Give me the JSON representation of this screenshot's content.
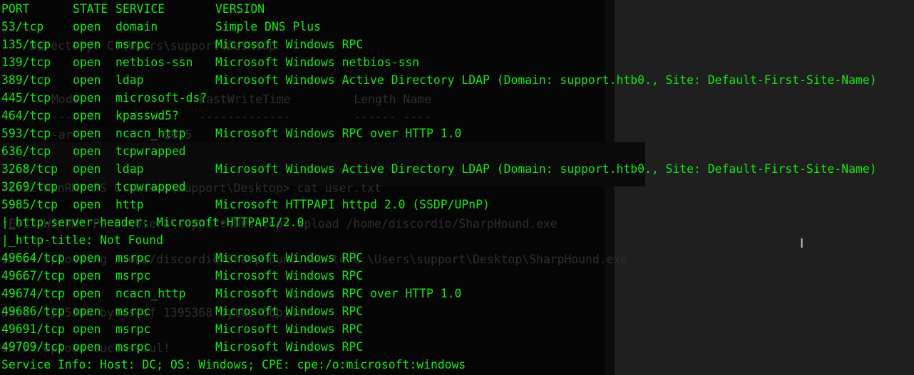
{
  "terminal": {
    "header": {
      "port": "PORT",
      "state": "STATE",
      "service": "SERVICE",
      "version": "VERSION"
    },
    "rows": [
      {
        "port": "53/tcp",
        "state": "open",
        "service": "domain",
        "version": "Simple DNS Plus"
      },
      {
        "port": "135/tcp",
        "state": "open",
        "service": "msrpc",
        "version": "Microsoft Windows RPC"
      },
      {
        "port": "139/tcp",
        "state": "open",
        "service": "netbios-ssn",
        "version": "Microsoft Windows netbios-ssn"
      },
      {
        "port": "389/tcp",
        "state": "open",
        "service": "ldap",
        "version": "Microsoft Windows Active Directory LDAP (Domain: support.htb0., Site: Default-First-Site-Name)"
      },
      {
        "port": "445/tcp",
        "state": "open",
        "service": "microsoft-ds?",
        "version": ""
      },
      {
        "port": "464/tcp",
        "state": "open",
        "service": "kpasswd5?",
        "version": ""
      },
      {
        "port": "593/tcp",
        "state": "open",
        "service": "ncacn_http",
        "version": "Microsoft Windows RPC over HTTP 1.0"
      },
      {
        "port": "636/tcp",
        "state": "open",
        "service": "tcpwrapped",
        "version": ""
      },
      {
        "port": "3268/tcp",
        "state": "open",
        "service": "ldap",
        "version": "Microsoft Windows Active Directory LDAP (Domain: support.htb0., Site: Default-First-Site-Name)"
      },
      {
        "port": "3269/tcp",
        "state": "open",
        "service": "tcpwrapped",
        "version": ""
      },
      {
        "port": "5985/tcp",
        "state": "open",
        "service": "http",
        "version": "Microsoft HTTPAPI httpd 2.0 (SSDP/UPnP)"
      }
    ],
    "http_server_header": "|_http-server-header: Microsoft-HTTPAPI/2.0",
    "http_title": "|_http-title: Not Found",
    "rows2": [
      {
        "port": "49664/tcp",
        "state": "open",
        "service": "msrpc",
        "version": "Microsoft Windows RPC"
      },
      {
        "port": "49667/tcp",
        "state": "open",
        "service": "msrpc",
        "version": "Microsoft Windows RPC"
      },
      {
        "port": "49674/tcp",
        "state": "open",
        "service": "ncacn_http",
        "version": "Microsoft Windows RPC over HTTP 1.0"
      },
      {
        "port": "49686/tcp",
        "state": "open",
        "service": "msrpc",
        "version": "Microsoft Windows RPC"
      },
      {
        "port": "49691/tcp",
        "state": "open",
        "service": "msrpc",
        "version": "Microsoft Windows RPC"
      },
      {
        "port": "49709/tcp",
        "state": "open",
        "service": "msrpc",
        "version": "Microsoft Windows RPC"
      }
    ],
    "service_info": "Service Info: Host: DC; OS: Windows; CPE: cpe:/o:microsoft:windows",
    "text_color": "#15e815",
    "background_color": "#050505",
    "cursor_icon": "text-cursor-icon"
  },
  "ghost_window": {
    "lines": [
      "    Directory: C:\\Users\\support\\Desktop",
      "Mode                 LastWriteTime         Length Name",
      "----                 -------------         ------ ----",
      "-ar---          2025",
      "*Evil-WinRM* PS C:\\Users\\support\\Desktop> cat user.txt",
      "*Evil-WinRM* PS C:\\Users\\support\\Desktop> upload /home/discordio/SharpHound.exe",
      "Info: Uploading /home/discordio/SharpHound.exe to C:\\Users\\support\\Desktop\\SharpHound.exe",
      "Data: 1395368 bytes of 1395368 bytes copied",
      "Info: Upload successful!"
    ]
  }
}
